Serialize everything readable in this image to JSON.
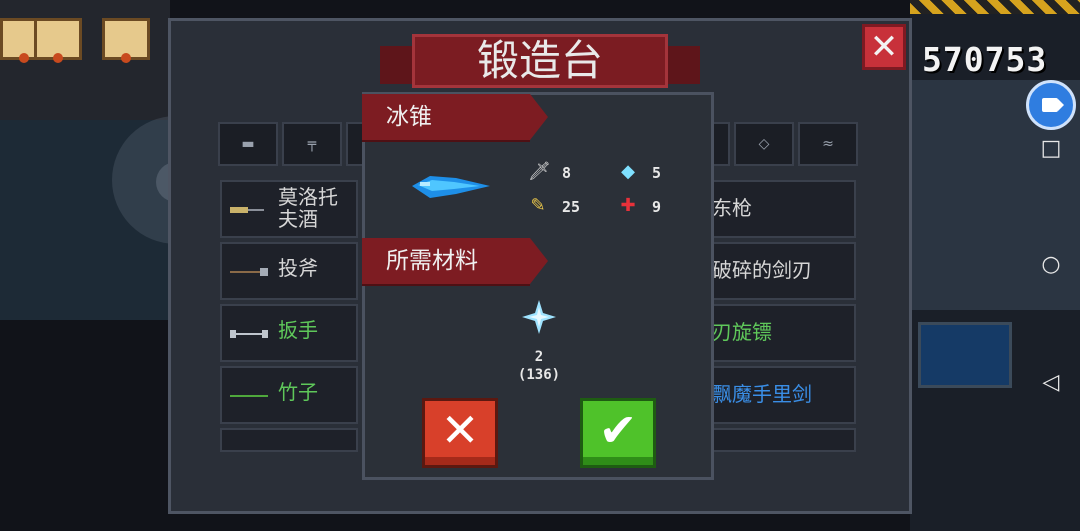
{
  "hud": {
    "score": "570753"
  },
  "forge": {
    "title": "锻造台",
    "tabs": [
      "▬",
      "╤",
      "",
      "",
      "╤",
      "◇",
      "≈"
    ],
    "left_rows": [
      {
        "label": "莫洛托夫酒",
        "color": "#d7d7d7"
      },
      {
        "label": "投斧",
        "color": "#d7d7d7"
      },
      {
        "label": "扳手",
        "color": "#5fc85a"
      },
      {
        "label": "竹子",
        "color": "#5fc85a"
      }
    ],
    "right_rows": [
      {
        "label": "东枪",
        "color": "#d7d7d7"
      },
      {
        "label": "破碎的剑刃",
        "color": "#d7d7d7"
      },
      {
        "label": "刃旋镖",
        "color": "#5fc85a"
      },
      {
        "label": "飘魔手里剑",
        "color": "#3a8ee6"
      }
    ]
  },
  "popup": {
    "weapon_name": "冰锥",
    "stats": {
      "attack": "8",
      "energy": "5",
      "critical": "25",
      "accuracy": "9"
    },
    "materials_header": "所需材料",
    "material": {
      "required": "2",
      "owned": "(136)"
    },
    "cancel_label": "✕",
    "confirm_label": "✔"
  },
  "colors": {
    "ribbon": "#7d1c22",
    "cancel": "#d8402a",
    "confirm": "#4fc22a",
    "record": "#2f7de0"
  },
  "icons": {
    "close": "close-icon",
    "attack": "sword-icon",
    "energy": "diamond-icon",
    "critical": "feather-icon",
    "accuracy": "crosshair-icon",
    "material": "ice-crystal-icon"
  }
}
